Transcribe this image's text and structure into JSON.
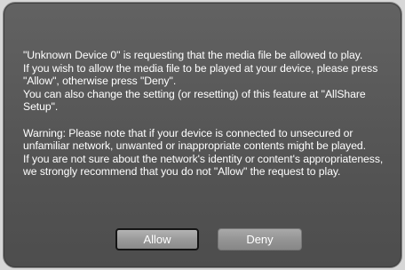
{
  "dialog": {
    "paragraphs": [
      "\"Unknown Device 0\" is requesting that the media file be allowed to play.",
      "If you wish to allow the media file to be played at your device, please press \"Allow\", otherwise press \"Deny\".",
      "You can also change the setting (or resetting) of this feature at \"AllShare Setup\".",
      "Warning: Please note that if your device is connected to unsecured or unfamiliar network, unwanted or inappropriate contents might be played.",
      "If you are not sure about the network's identity or content's appropriateness, we strongly recommend that you do not \"Allow\" the request to play."
    ],
    "buttons": {
      "allow_label": "Allow",
      "deny_label": "Deny"
    }
  },
  "colors": {
    "dialog_background": "#565656",
    "text": "#ffffff",
    "focused_button_border": "#141414"
  }
}
